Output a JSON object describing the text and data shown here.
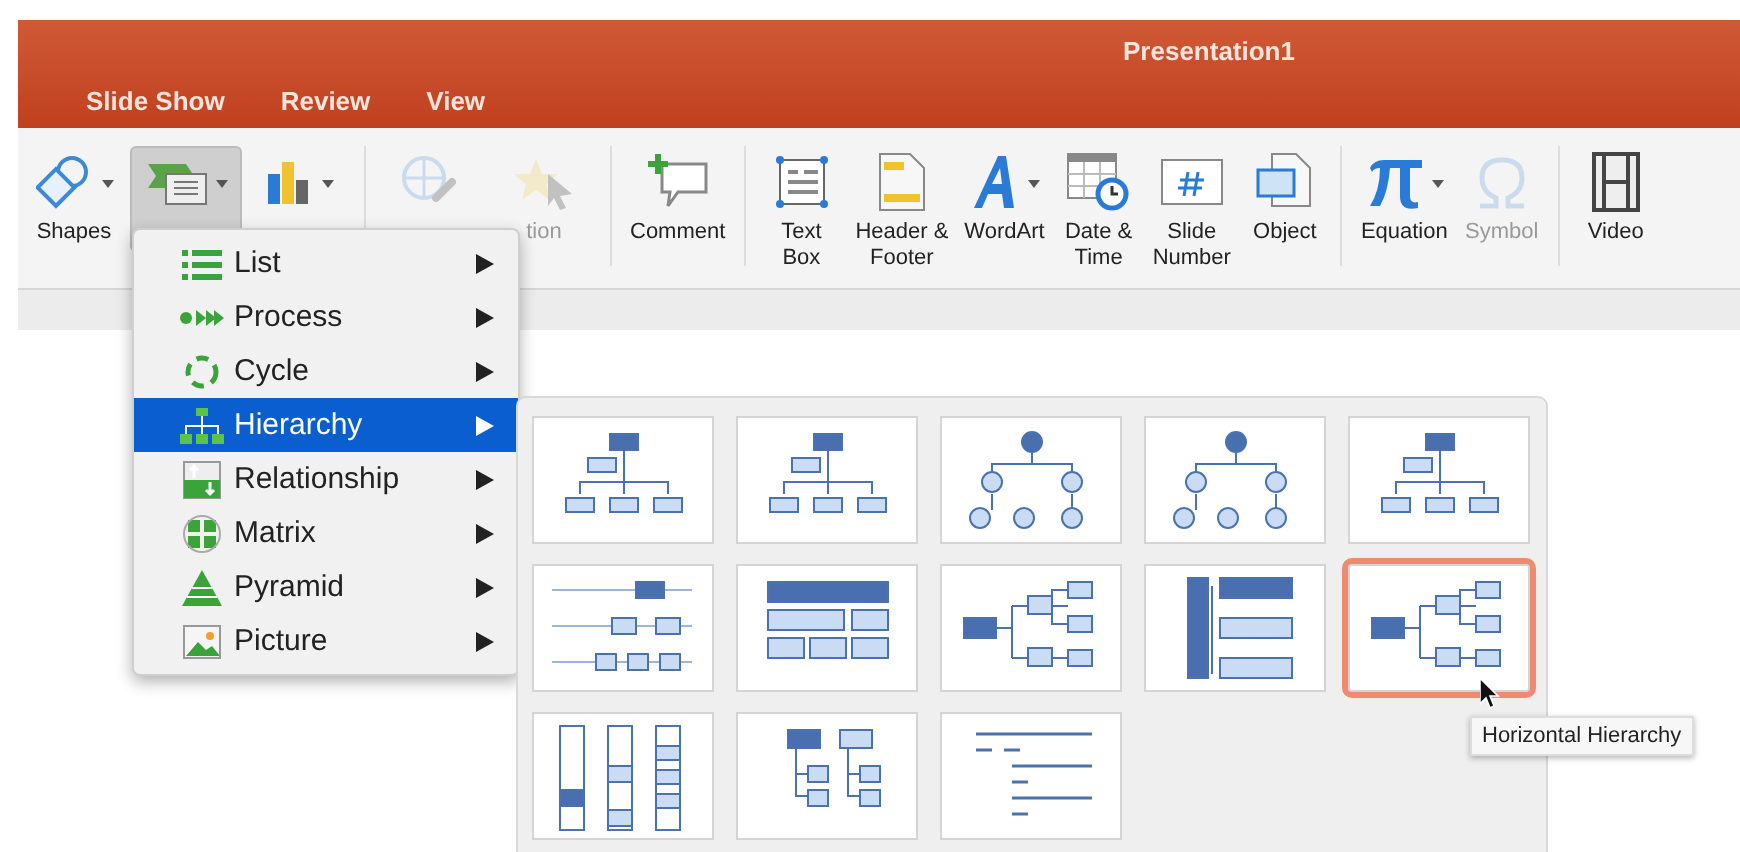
{
  "window": {
    "title": "Presentation1"
  },
  "tabs": [
    {
      "label": "Slide Show",
      "selected": false
    },
    {
      "label": "Review",
      "selected": false
    },
    {
      "label": "View",
      "selected": false
    }
  ],
  "ribbon": {
    "groups": [
      [
        {
          "kind": "shapes",
          "label": "Shapes",
          "dropdown": true,
          "pressed": false,
          "disabled": false
        },
        {
          "kind": "smartart",
          "dropdown": true,
          "pressed": true,
          "disabled": false
        },
        {
          "kind": "chart",
          "dropdown": true,
          "pressed": false,
          "disabled": false
        }
      ],
      [
        {
          "kind": "hyperlink",
          "dropdown": false,
          "pressed": false,
          "disabled": true
        },
        {
          "kind": "action",
          "label": "tion",
          "dropdown": false,
          "pressed": false,
          "disabled": true
        }
      ],
      [
        {
          "kind": "comment",
          "label": "Comment",
          "dropdown": false,
          "pressed": false,
          "disabled": false
        }
      ],
      [
        {
          "kind": "textbox",
          "label": "Text\nBox",
          "dropdown": false,
          "pressed": false,
          "disabled": false
        },
        {
          "kind": "header",
          "label": "Header &\nFooter",
          "dropdown": false,
          "pressed": false,
          "disabled": false
        },
        {
          "kind": "wordart",
          "label": "WordArt",
          "dropdown": true,
          "pressed": false,
          "disabled": false
        },
        {
          "kind": "datetime",
          "label": "Date &\nTime",
          "dropdown": false,
          "pressed": false,
          "disabled": false
        },
        {
          "kind": "slidenumber",
          "label": "Slide\nNumber",
          "dropdown": false,
          "pressed": false,
          "disabled": false
        },
        {
          "kind": "object",
          "label": "Object",
          "dropdown": false,
          "pressed": false,
          "disabled": false
        }
      ],
      [
        {
          "kind": "equation",
          "label": "Equation",
          "dropdown": true,
          "pressed": false,
          "disabled": false
        },
        {
          "kind": "symbol",
          "label": "Symbol",
          "dropdown": false,
          "pressed": false,
          "disabled": true
        }
      ],
      [
        {
          "kind": "video",
          "label": "Video",
          "dropdown": false,
          "pressed": false,
          "disabled": false
        }
      ]
    ]
  },
  "menu": {
    "items": [
      {
        "kind": "list",
        "label": "List",
        "selected": false
      },
      {
        "kind": "process",
        "label": "Process",
        "selected": false
      },
      {
        "kind": "cycle",
        "label": "Cycle",
        "selected": false
      },
      {
        "kind": "hierarchy",
        "label": "Hierarchy",
        "selected": true
      },
      {
        "kind": "relationship",
        "label": "Relationship",
        "selected": false
      },
      {
        "kind": "matrix",
        "label": "Matrix",
        "selected": false
      },
      {
        "kind": "pyramid",
        "label": "Pyramid",
        "selected": false
      },
      {
        "kind": "picture",
        "label": "Picture",
        "selected": false
      }
    ]
  },
  "gallery": {
    "layouts": [
      {
        "kind": "org",
        "selected": false
      },
      {
        "kind": "org",
        "selected": false
      },
      {
        "kind": "circles",
        "selected": false
      },
      {
        "kind": "circles",
        "selected": false
      },
      {
        "kind": "org",
        "selected": false
      },
      {
        "kind": "labeled",
        "selected": false
      },
      {
        "kind": "table",
        "selected": false
      },
      {
        "kind": "horizontal",
        "selected": false
      },
      {
        "kind": "bracket",
        "selected": false
      },
      {
        "kind": "horizontal",
        "selected": true
      },
      {
        "kind": "columns",
        "selected": false
      },
      {
        "kind": "tree",
        "selected": false
      },
      {
        "kind": "lines",
        "selected": false
      }
    ],
    "tooltip": "Horizontal Hierarchy"
  }
}
